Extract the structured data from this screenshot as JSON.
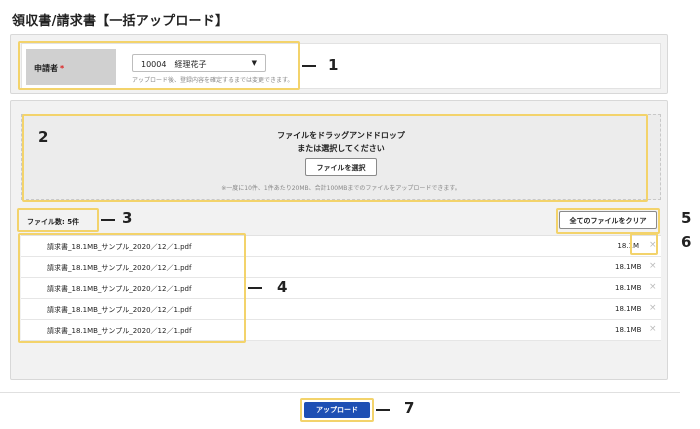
{
  "page": {
    "title": "領収書/請求書【一括アップロード】"
  },
  "applicant": {
    "label": "申請者",
    "required_mark": "*",
    "selected_value": "10004　経理花子",
    "help_text": "アップロード後、登録内容を確定するまでは変更できます。"
  },
  "dropzone": {
    "line1": "ファイルをドラッグアンドドロップ",
    "line2": "または選択してください",
    "select_button": "ファイルを選択",
    "note": "※一度に10件、1件あたり20MB、合計100MBまでのファイルをアップロードできます。"
  },
  "files": {
    "count_label": "ファイル数: 5件",
    "clear_all_button": "全てのファイルをクリア",
    "items": [
      {
        "name": "請求書_18.1MB_サンプル_2020／12／1.pdf",
        "size": "18.1M",
        "delete_icon": "×"
      },
      {
        "name": "請求書_18.1MB_サンプル_2020／12／1.pdf",
        "size": "18.1MB",
        "delete_icon": "×"
      },
      {
        "name": "請求書_18.1MB_サンプル_2020／12／1.pdf",
        "size": "18.1MB",
        "delete_icon": "×"
      },
      {
        "name": "請求書_18.1MB_サンプル_2020／12／1.pdf",
        "size": "18.1MB",
        "delete_icon": "×"
      },
      {
        "name": "請求書_18.1MB_サンプル_2020／12／1.pdf",
        "size": "18.1MB",
        "delete_icon": "×"
      }
    ]
  },
  "footer": {
    "upload_button": "アップロード"
  },
  "annotations": {
    "labels": [
      "1",
      "2",
      "3",
      "4",
      "5",
      "6",
      "7"
    ],
    "highlight_color": "#f3d36b"
  },
  "colors": {
    "primary": "#1e4fb4",
    "required": "#dd2222"
  }
}
